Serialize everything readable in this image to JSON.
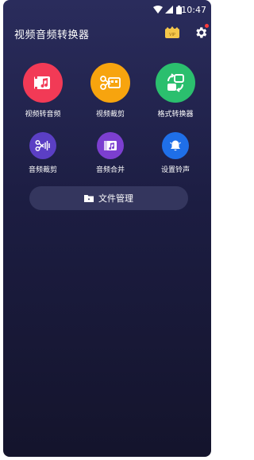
{
  "status": {
    "time": "10:47"
  },
  "header": {
    "title": "视频音频转换器",
    "vip_badge": "VIP"
  },
  "tools_primary": [
    {
      "label": "视频转音频",
      "color": "#f23a56",
      "icon": "video-music-icon"
    },
    {
      "label": "视频裁剪",
      "color": "#f7a40e",
      "icon": "video-scissors-icon"
    },
    {
      "label": "格式转换器",
      "color": "#2bbf6e",
      "icon": "convert-icon"
    }
  ],
  "tools_secondary": [
    {
      "label": "音频裁剪",
      "color": "#5b3fc4",
      "icon": "audio-scissors-icon"
    },
    {
      "label": "音频合并",
      "color": "#7c3fd0",
      "icon": "audio-merge-icon"
    },
    {
      "label": "设置铃声",
      "color": "#1f6fe8",
      "icon": "bell-icon"
    }
  ],
  "file_manager": {
    "label": "文件管理"
  }
}
